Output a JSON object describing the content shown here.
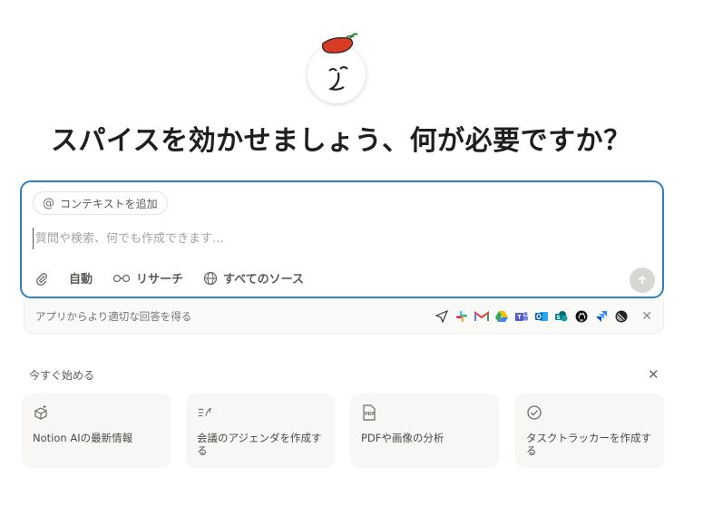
{
  "header": {
    "title": "スパイスを効かせましょう、何が必要ですか？",
    "avatar_icon": "notion-ai-face-icon",
    "pepper_icon": "chili-pepper-icon"
  },
  "chat": {
    "context_chip": "コンテキストを追加",
    "context_icon": "at-icon",
    "placeholder": "質問や検索、何でも作成できます...",
    "toolbar": {
      "attach_icon": "paperclip-icon",
      "auto_label": "自動",
      "research_label": "リサーチ",
      "sources_label": "すべてのソース"
    },
    "send_icon": "arrow-up-icon",
    "accent": "#2f7fc1"
  },
  "apps_bar": {
    "label": "アプリからより適切な回答を得る",
    "icons": [
      "paper-plane-icon",
      "slack-icon",
      "gmail-icon",
      "google-drive-icon",
      "teams-icon",
      "outlook-icon",
      "sharepoint-icon",
      "github-icon",
      "jira-icon",
      "linear-icon"
    ],
    "close_icon": "close-icon"
  },
  "get_started": {
    "heading": "今すぐ始める",
    "close_icon": "close-icon",
    "cards": [
      {
        "label": "Notion AIの最新情報",
        "icon": "box-sparkle-icon"
      },
      {
        "label": "会議のアジェンダを作成する",
        "icon": "list-pen-icon"
      },
      {
        "label": "PDFや画像の分析",
        "icon": "pdf-icon"
      },
      {
        "label": "タスクトラッカーを作成する",
        "icon": "check-circle-icon"
      }
    ]
  }
}
